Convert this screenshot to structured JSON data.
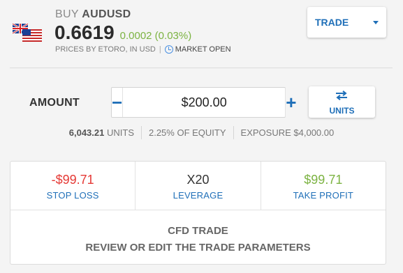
{
  "header": {
    "action": "BUY",
    "symbol": "AUDUSD",
    "price": "0.6619",
    "change": "0.0002 (0.03%)",
    "prices_by": "PRICES BY ETORO, IN USD",
    "separator": "|",
    "market_status": "MARKET OPEN",
    "flag_icon": "au-us-flag-icon"
  },
  "trade_dropdown": {
    "label": "TRADE"
  },
  "amount": {
    "label": "AMOUNT",
    "value": "$200.00",
    "minus": "−",
    "plus": "+"
  },
  "units_toggle": {
    "label": "UNITS",
    "icon": "swap-arrows-icon"
  },
  "stats": {
    "units_num": "6,043.21",
    "units_label": "UNITS",
    "equity": "2.25% OF EQUITY",
    "exposure": "EXPOSURE $4,000.00"
  },
  "params": {
    "stop_loss": {
      "value": "-$99.71",
      "label": "STOP LOSS"
    },
    "leverage": {
      "value": "X20",
      "label": "LEVERAGE"
    },
    "take_profit": {
      "value": "$99.71",
      "label": "TAKE PROFIT"
    }
  },
  "cfd": {
    "title": "CFD TRADE",
    "subtitle": "REVIEW OR EDIT THE TRADE PARAMETERS"
  },
  "colors": {
    "accent": "#1f6fb8",
    "positive": "#7cb342",
    "negative": "#e53935"
  }
}
